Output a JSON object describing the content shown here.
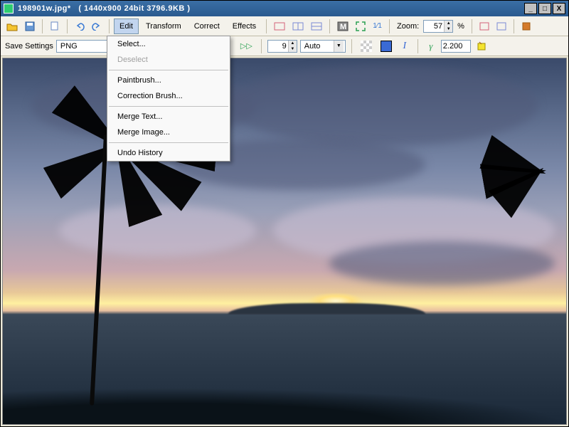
{
  "titlebar": {
    "filename": "198901w.jpg*",
    "info": "( 1440x900 24bit 3796.9KB )"
  },
  "menubar": {
    "edit": "Edit",
    "transform": "Transform",
    "correct": "Correct",
    "effects": "Effects",
    "zoom_label": "Zoom:",
    "zoom_value": "57",
    "zoom_pct": "%"
  },
  "toolbar2": {
    "save_settings": "Save Settings",
    "format": "PNG",
    "num_value": "9",
    "auto": "Auto",
    "gamma": "2.200"
  },
  "edit_menu": {
    "select": "Select...",
    "deselect": "Deselect",
    "paintbrush": "Paintbrush...",
    "correction_brush": "Correction Brush...",
    "merge_text": "Merge Text...",
    "merge_image": "Merge Image...",
    "undo_history": "Undo History"
  }
}
